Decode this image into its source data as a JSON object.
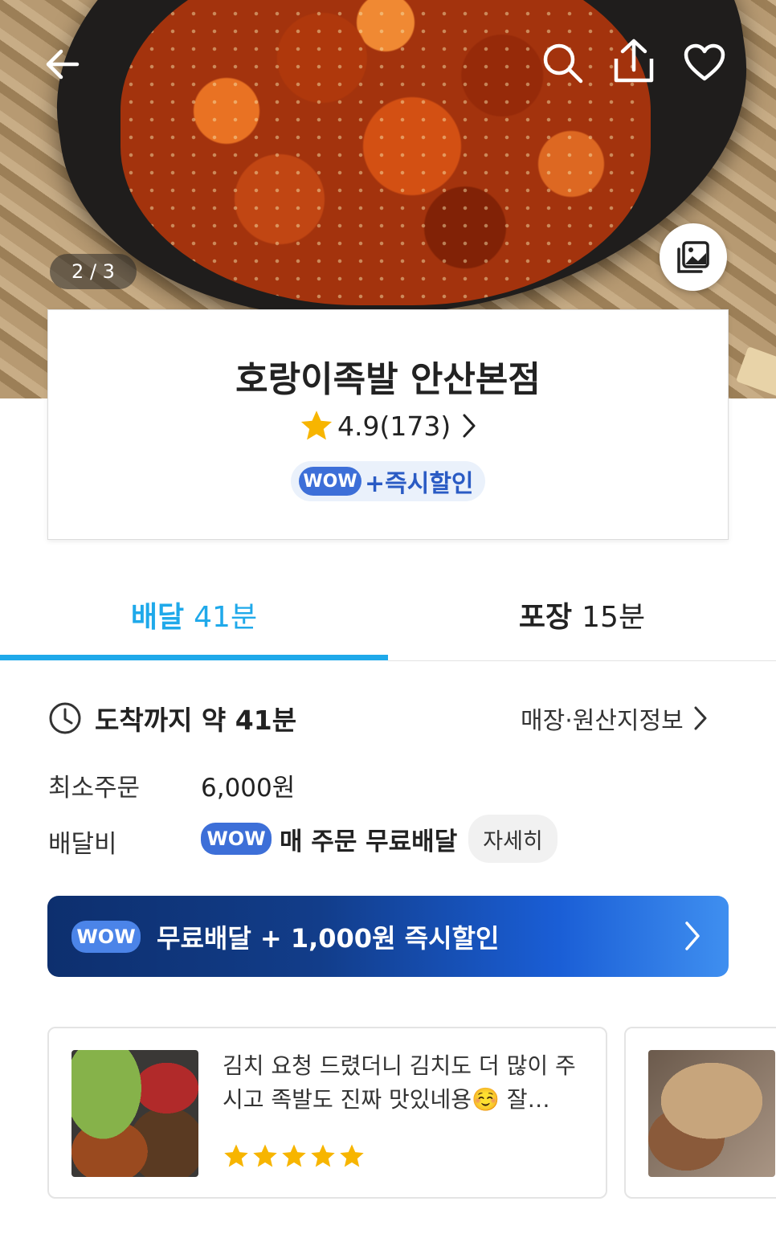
{
  "hero": {
    "page_indicator": "2 / 3",
    "icons": {
      "back": "arrow-left-icon",
      "search": "search-icon",
      "share": "share-icon",
      "favorite": "heart-icon",
      "gallery": "gallery-icon"
    }
  },
  "store": {
    "name": "호랑이족발 안산본점",
    "rating": "4.9(173)",
    "promo_badge": "WOW",
    "promo_text": "+즉시할인"
  },
  "tabs": [
    {
      "label": "배달",
      "time": "41분",
      "active": true
    },
    {
      "label": "포장",
      "time": "15분",
      "active": false
    }
  ],
  "info": {
    "arrival": "도착까지 약 41분",
    "store_info_link": "매장·원산지정보",
    "min_order_label": "최소주문",
    "min_order_value": "6,000원",
    "delivery_fee_label": "배달비",
    "delivery_fee_badge": "WOW",
    "delivery_fee_text": "매 주문 무료배달",
    "detail_button": "자세히"
  },
  "banner": {
    "badge": "WOW",
    "text": "무료배달 + 1,000원 즉시할인"
  },
  "reviews": [
    {
      "text": "김치 요청 드렸더니 김치도 더 많이 주시고 족발도 진짜 맛있네용☺️ 잘…",
      "stars": 5
    }
  ],
  "colors": {
    "accent": "#1fa9ea",
    "wow_blue": "#3d6fd8",
    "star": "#f7b500",
    "banner_start": "#0d2f6e",
    "banner_end": "#3f8ff0"
  }
}
